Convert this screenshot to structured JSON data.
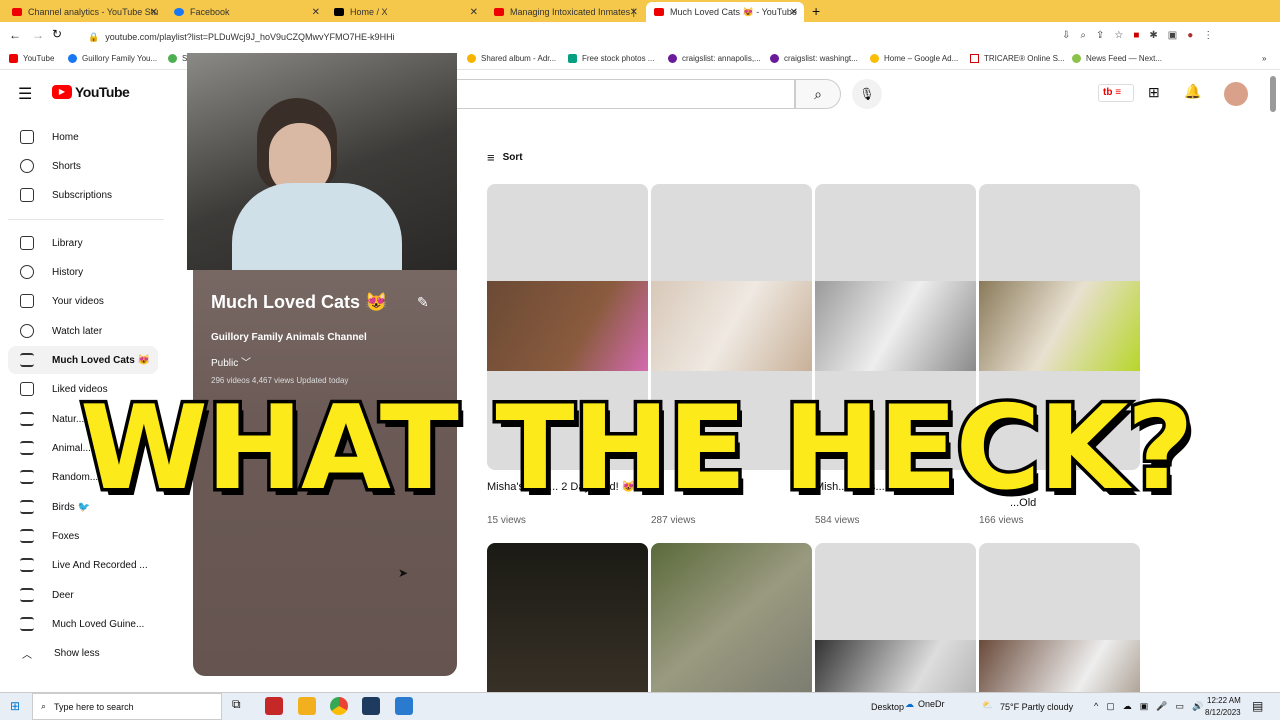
{
  "browser": {
    "tabs": [
      {
        "label": "Channel analytics - YouTube Stu",
        "color": "#e00"
      },
      {
        "label": "Facebook",
        "color": "#1877f2"
      },
      {
        "label": "Home / X",
        "color": "#000"
      },
      {
        "label": "Managing Intoxicated Inmates |",
        "color": "#e00"
      },
      {
        "label": "Much Loved Cats 😻 - YouTube",
        "color": "#e00"
      }
    ],
    "new_tab": "+",
    "url": "youtube.com/playlist?list=PLDuWcj9J_hoV9uCZQMwvYFMO7HE-k9HHi",
    "bookmarks": [
      "YouTube",
      "Guillory Family You...",
      "S",
      "Shared album - Adr...",
      "Free stock photos ...",
      "craigslist: annapolis,...",
      "craigslist: washingt...",
      "Home – Google Ad...",
      "TRICARE® Online S...",
      "News Feed — Next..."
    ],
    "more": "»"
  },
  "youtube": {
    "logo": "YouTube",
    "sidebar": [
      "Home",
      "Shorts",
      "Subscriptions",
      "Library",
      "History",
      "Your videos",
      "Watch later",
      "Much Loved Cats 😻",
      "Liked videos",
      "Natur...",
      "Animal...",
      "Random...",
      "Birds 🐦",
      "Foxes",
      "Live And Recorded ...",
      "Deer",
      "Much Loved Guine...",
      "Show less"
    ],
    "sort": "Sort",
    "playlist": {
      "title": "Much Loved Cats 😻",
      "channel": "Guillory Family Animals Channel",
      "visibility": "Public",
      "stats": "296 videos  4,467 views  Updated today"
    },
    "videos": [
      {
        "title": "Misha's Kitte... 2 Days Old! 😻",
        "views": "15 views"
      },
      {
        "title": "",
        "views": "287 views"
      },
      {
        "title": "Mish... Days...",
        "views": "584 views"
      },
      {
        "title": "...Old",
        "views": "166 views"
      }
    ]
  },
  "overlay_text": "WHAT THE HECK?",
  "taskbar": {
    "search": "Type here to search",
    "desktop": "Desktop",
    "onedrive": "OneDr",
    "weather": "75°F  Partly cloudy",
    "time": "12:22 AM",
    "date": "8/12/2023"
  }
}
